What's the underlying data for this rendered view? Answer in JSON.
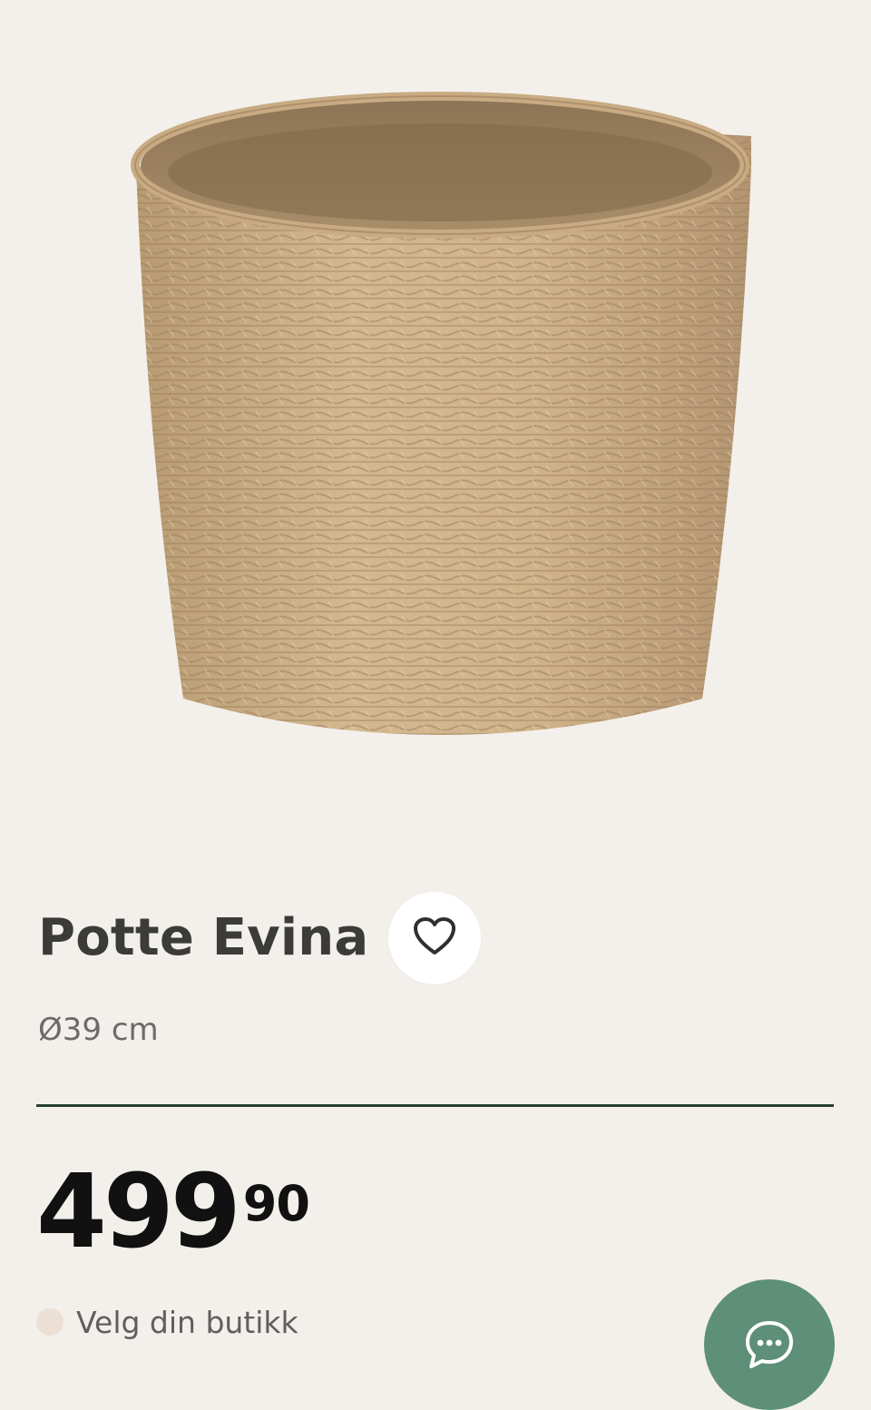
{
  "product": {
    "name": "Potte Evina",
    "variant": "Ø39 cm",
    "price_integer": "499",
    "price_decimal": "90"
  },
  "store": {
    "label": "Velg din butikk"
  },
  "icons": {
    "favorite": "heart-icon",
    "chat": "chat-bubble-icon"
  },
  "colors": {
    "background": "#f3f0eb",
    "divider": "#27402e",
    "chat_button": "#5d8f79",
    "store_dot": "#ebe0d3"
  }
}
